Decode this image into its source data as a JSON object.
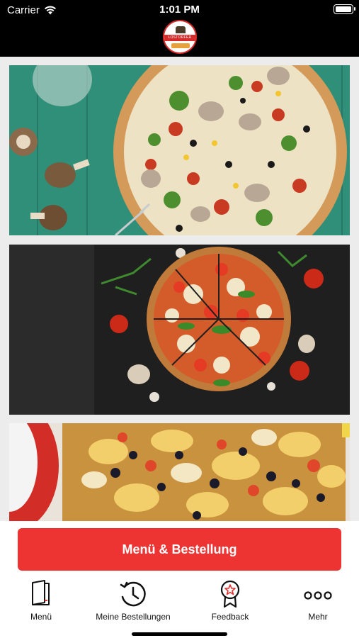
{
  "status_bar": {
    "carrier": "Carrier",
    "time": "1:01 PM"
  },
  "header": {
    "logo_text": "LOSTORFER HOMEPIZZA"
  },
  "promo_images": [
    {
      "name": "vegetable-pizza-on-wood",
      "icon": "pizza-photo"
    },
    {
      "name": "margherita-pizza-on-slate",
      "icon": "pizza-photo"
    },
    {
      "name": "olive-artichoke-pizza",
      "icon": "pizza-photo"
    }
  ],
  "order_button": {
    "label": "Menü & Bestellung",
    "color": "#ee3432"
  },
  "tabbar": {
    "items": [
      {
        "label": "Menü",
        "icon": "menu-book-icon"
      },
      {
        "label": "Meine Bestellungen",
        "icon": "history-clock-icon"
      },
      {
        "label": "Feedback",
        "icon": "award-badge-icon"
      },
      {
        "label": "Mehr",
        "icon": "more-dots-icon"
      }
    ]
  },
  "colors": {
    "accent": "#ee3432",
    "header_bg": "#000000",
    "page_bg": "#ececec"
  }
}
